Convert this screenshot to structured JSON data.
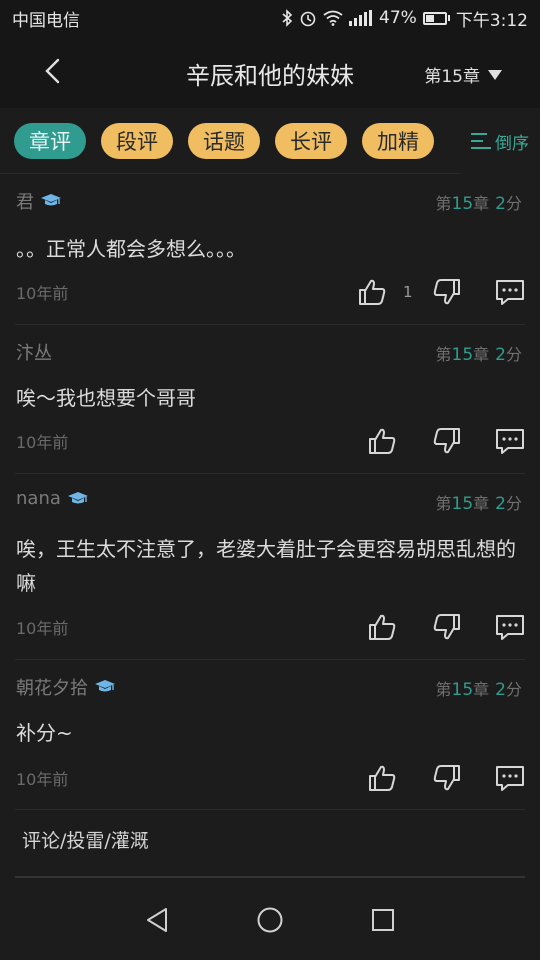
{
  "status_bar": {
    "carrier": "中国电信",
    "battery": "47%",
    "time": "下午3:12",
    "battery_level": 0.47
  },
  "header": {
    "title": "辛辰和他的妹妹",
    "chapter": "第15章"
  },
  "filter": {
    "tabs": [
      {
        "label": "章评",
        "active": true
      },
      {
        "label": "段评",
        "active": false
      },
      {
        "label": "话题",
        "active": false
      },
      {
        "label": "长评",
        "active": false
      },
      {
        "label": "加精",
        "active": false
      }
    ],
    "sort_label": "倒序"
  },
  "comments": [
    {
      "user": "君",
      "badge": true,
      "chap_prefix": "第",
      "chap_num": "15",
      "chap_suffix": "章",
      "points": "2",
      "points_unit": "分",
      "text": "。。正常人都会多想么。。。",
      "time": "10年前",
      "likes": "1"
    },
    {
      "user": "汴丛",
      "badge": false,
      "chap_prefix": "第",
      "chap_num": "15",
      "chap_suffix": "章",
      "points": "2",
      "points_unit": "分",
      "text": "唉～我也想要个哥哥",
      "time": "10年前",
      "likes": ""
    },
    {
      "user": "nana",
      "badge": true,
      "chap_prefix": "第",
      "chap_num": "15",
      "chap_suffix": "章",
      "points": "2",
      "points_unit": "分",
      "text": "唉，王生太不注意了，老婆大着肚子会更容易胡思乱想的嘛",
      "time": "10年前",
      "likes": ""
    },
    {
      "user": "朝花夕拾",
      "badge": true,
      "chap_prefix": "第",
      "chap_num": "15",
      "chap_suffix": "章",
      "points": "2",
      "points_unit": "分",
      "text": "补分~",
      "time": "10年前",
      "likes": ""
    }
  ],
  "footer": {
    "entry_label": "评论/投雷/灌溉"
  },
  "colors": {
    "accent_teal": "#2f9c8f",
    "tab_yellow": "#f0bd61",
    "background": "#1c1c1c"
  }
}
